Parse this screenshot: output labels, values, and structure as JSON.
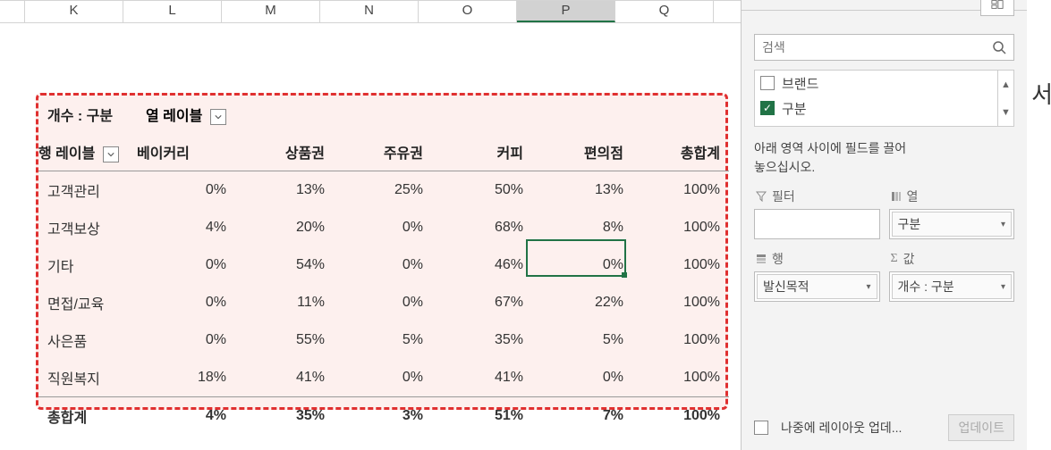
{
  "columns": [
    "K",
    "L",
    "M",
    "N",
    "O",
    "P",
    "Q"
  ],
  "activeColumn": "P",
  "pivot": {
    "cornerLabel": "개수 : 구분",
    "colFieldLabel": "열 레이블",
    "rowFieldLabel": "행 레이블",
    "colHeaders": [
      "베이커리",
      "상품권",
      "주유권",
      "커피",
      "편의점",
      "총합계"
    ],
    "rows": [
      {
        "label": "고객관리",
        "vals": [
          "0%",
          "13%",
          "25%",
          "50%",
          "13%",
          "100%"
        ]
      },
      {
        "label": "고객보상",
        "vals": [
          "4%",
          "20%",
          "0%",
          "68%",
          "8%",
          "100%"
        ]
      },
      {
        "label": "기타",
        "vals": [
          "0%",
          "54%",
          "0%",
          "46%",
          "0%",
          "100%"
        ]
      },
      {
        "label": "면접/교육",
        "vals": [
          "0%",
          "11%",
          "0%",
          "67%",
          "22%",
          "100%"
        ]
      },
      {
        "label": "사은품",
        "vals": [
          "0%",
          "55%",
          "5%",
          "35%",
          "5%",
          "100%"
        ]
      },
      {
        "label": "직원복지",
        "vals": [
          "18%",
          "41%",
          "0%",
          "41%",
          "0%",
          "100%"
        ]
      }
    ],
    "grandRow": {
      "label": "총합계",
      "vals": [
        "4%",
        "35%",
        "3%",
        "51%",
        "7%",
        "100%"
      ]
    }
  },
  "selectedCell": {
    "col": "P",
    "rowIndex": 2,
    "value": "0%"
  },
  "panel": {
    "searchPlaceholder": "검색",
    "fields": [
      {
        "label": "브랜드",
        "checked": false
      },
      {
        "label": "구분",
        "checked": true
      }
    ],
    "dragHintLine1": "아래 영역 사이에 필드를 끌어",
    "dragHintLine2": "놓으십시오.",
    "zones": {
      "filter": {
        "title": "필터",
        "chip": ""
      },
      "column": {
        "title": "열",
        "chip": "구분"
      },
      "row": {
        "title": "행",
        "chip": "발신목적"
      },
      "values": {
        "title": "값",
        "chip": "개수 : 구분"
      }
    },
    "deferLabel": "나중에 레이아웃 업데...",
    "updateBtn": "업데이트"
  },
  "sideText": "서"
}
